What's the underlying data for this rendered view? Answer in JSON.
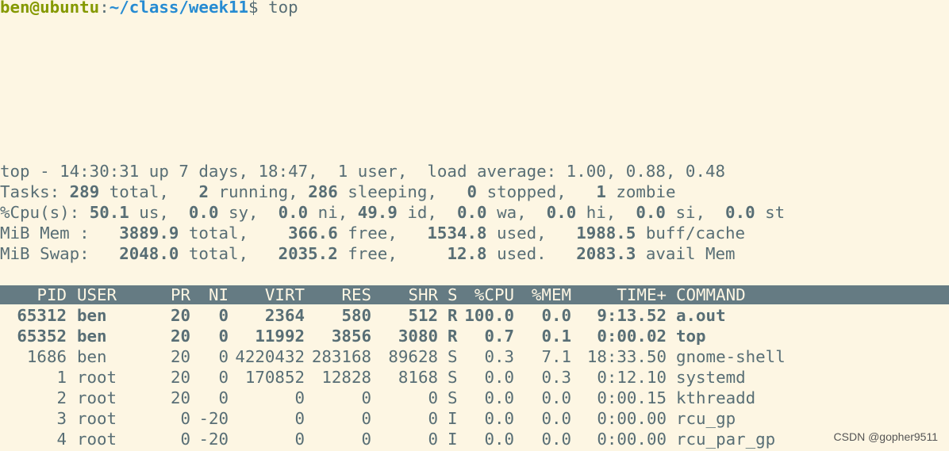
{
  "prompt": {
    "user_host": "ben@ubuntu",
    "separator": ":",
    "path": "~/class/week11",
    "symbol": "$",
    "command": " top"
  },
  "summary": {
    "top_line": "top - 14:30:31 up 7 days, 18:47,  1 user,  load average: 1.00, 0.88, 0.48",
    "tasks": {
      "label": "Tasks: ",
      "total": "289",
      "total_label": " total,   ",
      "running": "2",
      "running_label": " running, ",
      "sleeping": "286",
      "sleeping_label": " sleeping,   ",
      "stopped": "0",
      "stopped_label": " stopped,   ",
      "zombie": "1",
      "zombie_label": " zombie"
    },
    "cpu": {
      "label": "%Cpu(s): ",
      "us": "50.1",
      "us_label": " us,  ",
      "sy": "0.0",
      "sy_label": " sy,  ",
      "ni": "0.0",
      "ni_label": " ni, ",
      "id": "49.9",
      "id_label": " id,  ",
      "wa": "0.0",
      "wa_label": " wa,  ",
      "hi": "0.0",
      "hi_label": " hi,  ",
      "si": "0.0",
      "si_label": " si,  ",
      "st": "0.0",
      "st_label": " st"
    },
    "mem": {
      "label": "MiB Mem :   ",
      "total": "3889.9",
      "total_label": " total,    ",
      "free": "366.6",
      "free_label": " free,   ",
      "used": "1534.8",
      "used_label": " used,   ",
      "buff": "1988.5",
      "buff_label": " buff/cache"
    },
    "swap": {
      "label": "MiB Swap:   ",
      "total": "2048.0",
      "total_label": " total,   ",
      "free": "2035.2",
      "free_label": " free,     ",
      "used": "12.8",
      "used_label": " used.   ",
      "avail": "2083.3",
      "avail_label": " avail Mem"
    }
  },
  "table": {
    "headers": [
      "PID",
      "USER",
      "PR",
      "NI",
      "VIRT",
      "RES",
      "SHR",
      "S",
      "%CPU",
      "%MEM",
      "TIME+",
      "COMMAND"
    ],
    "rows": [
      {
        "bold": true,
        "cells": [
          "65312",
          "ben",
          "20",
          "0",
          "2364",
          "580",
          "512",
          "R",
          "100.0",
          "0.0",
          "9:13.52",
          "a.out"
        ]
      },
      {
        "bold": true,
        "cells": [
          "65352",
          "ben",
          "20",
          "0",
          "11992",
          "3856",
          "3080",
          "R",
          "0.7",
          "0.1",
          "0:00.02",
          "top"
        ]
      },
      {
        "bold": false,
        "cells": [
          "1686",
          "ben",
          "20",
          "0",
          "4220432",
          "283168",
          "89628",
          "S",
          "0.3",
          "7.1",
          "18:33.50",
          "gnome-shell"
        ]
      },
      {
        "bold": false,
        "cells": [
          "1",
          "root",
          "20",
          "0",
          "170852",
          "12828",
          "8168",
          "S",
          "0.0",
          "0.3",
          "0:12.10",
          "systemd"
        ]
      },
      {
        "bold": false,
        "cells": [
          "2",
          "root",
          "20",
          "0",
          "0",
          "0",
          "0",
          "S",
          "0.0",
          "0.0",
          "0:00.15",
          "kthreadd"
        ]
      },
      {
        "bold": false,
        "cells": [
          "3",
          "root",
          "0",
          "-20",
          "0",
          "0",
          "0",
          "I",
          "0.0",
          "0.0",
          "0:00.00",
          "rcu_gp"
        ]
      },
      {
        "bold": false,
        "cells": [
          "4",
          "root",
          "0",
          "-20",
          "0",
          "0",
          "0",
          "I",
          "0.0",
          "0.0",
          "0:00.00",
          "rcu_par_gp"
        ]
      }
    ]
  },
  "watermark": "CSDN @gopher9511"
}
